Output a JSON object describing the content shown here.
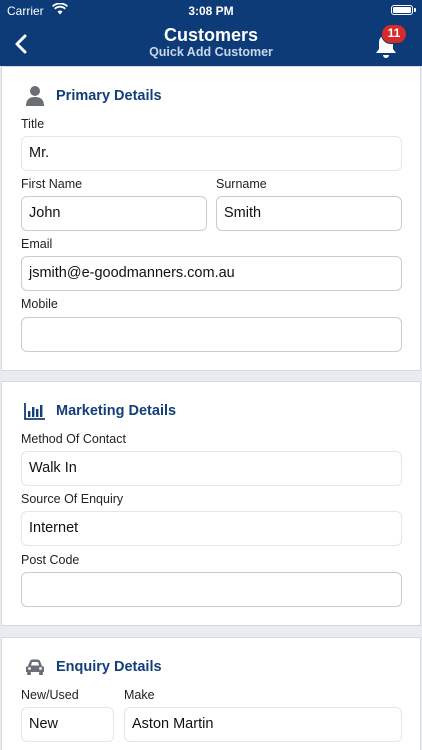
{
  "status": {
    "carrier": "Carrier",
    "time": "3:08 PM"
  },
  "header": {
    "title": "Customers",
    "subtitle": "Quick Add Customer",
    "notification_count": "11"
  },
  "primary": {
    "heading": "Primary Details",
    "title_label": "Title",
    "title_value": "Mr.",
    "first_name_label": "First Name",
    "first_name_value": "John",
    "surname_label": "Surname",
    "surname_value": "Smith",
    "email_label": "Email",
    "email_value": "jsmith@e-goodmanners.com.au",
    "mobile_label": "Mobile",
    "mobile_value": ""
  },
  "marketing": {
    "heading": "Marketing Details",
    "method_label": "Method Of Contact",
    "method_value": "Walk In",
    "source_label": "Source Of Enquiry",
    "source_value": "Internet",
    "postcode_label": "Post Code",
    "postcode_value": ""
  },
  "enquiry": {
    "heading": "Enquiry Details",
    "new_used_label": "New/Used",
    "new_used_value": "New",
    "make_label": "Make",
    "make_value": "Aston Martin"
  },
  "colors": {
    "header_bg": "#0d3b78",
    "accent": "#123f78",
    "badge": "#d62b2b"
  }
}
